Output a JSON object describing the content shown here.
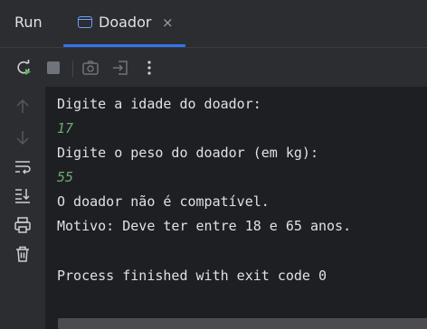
{
  "header": {
    "panel_title": "Run",
    "tab": {
      "label": "Doador",
      "close": "×"
    }
  },
  "toolbar": {
    "buttons": [
      {
        "name": "rerun",
        "icon": "rerun-icon"
      },
      {
        "name": "stop",
        "icon": "stop-icon"
      },
      {
        "name": "screenshot",
        "icon": "camera-icon"
      },
      {
        "name": "exit",
        "icon": "exit-icon"
      },
      {
        "name": "more",
        "icon": "more-vertical-icon"
      }
    ]
  },
  "sidebar": {
    "buttons": [
      {
        "name": "up",
        "icon": "arrow-up-icon"
      },
      {
        "name": "down",
        "icon": "arrow-down-icon"
      },
      {
        "name": "soft-wrap",
        "icon": "soft-wrap-icon"
      },
      {
        "name": "scroll-to-end",
        "icon": "scroll-to-end-icon"
      },
      {
        "name": "print",
        "icon": "printer-icon"
      },
      {
        "name": "clear",
        "icon": "trash-icon"
      }
    ]
  },
  "console": {
    "lines": [
      {
        "text": "Digite a idade do doador:",
        "type": "output"
      },
      {
        "text": "17",
        "type": "input"
      },
      {
        "text": "Digite o peso do doador (em kg):",
        "type": "output"
      },
      {
        "text": "55",
        "type": "input"
      },
      {
        "text": "O doador não é compatível.",
        "type": "output"
      },
      {
        "text": "Motivo: Deve ter entre 18 e 65 anos.",
        "type": "output"
      },
      {
        "text": "",
        "type": "output"
      },
      {
        "text": "Process finished with exit code 0",
        "type": "output"
      }
    ]
  },
  "colors": {
    "background": "#2b2d30",
    "console_bg": "#1e1f22",
    "text": "#dfe1e5",
    "input_text": "#6aab73",
    "accent": "#3574f0",
    "rerun_green": "#5fb865"
  }
}
